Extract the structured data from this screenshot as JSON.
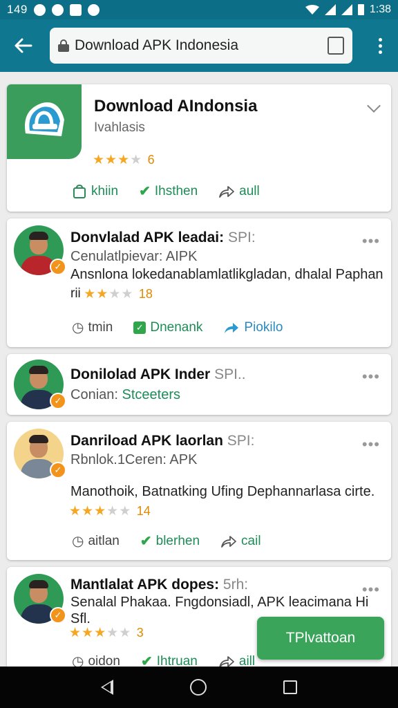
{
  "status_bar": {
    "time_left": "149",
    "time_right": "1:38"
  },
  "browser": {
    "url": "Download APK Indonesia",
    "tab_count": ""
  },
  "featured": {
    "title": "Download AIndonsia",
    "subtitle": "Ivahlasis",
    "rating": 3,
    "rating_label": "6",
    "actions": [
      "khiin",
      "Ihsthen",
      "aull"
    ]
  },
  "cards": [
    {
      "title": "Donvlalad APK leadai:",
      "title_muted": "SPI:",
      "line1": "Cenulatlpievar: AIPK",
      "line2": "Ansnlona lokedanablamlatlikgladan, dhalal Paphan",
      "rating_prefix": "rii",
      "rating": 2.5,
      "rating_label": "18",
      "actions": [
        "tmin",
        "Dnenank",
        "Piokilo"
      ]
    },
    {
      "title": "Donilolad  APK Inder",
      "title_muted": "SPI..",
      "line1": "Conian:",
      "line1_green": "Stceeters"
    },
    {
      "title": "Danriload APK  laorlan",
      "title_muted": "SPI:",
      "line1": "Rbnlok.1Ceren: APK",
      "line2": "Manothoik, Batnatking Ufing Dephannarlasa cirte.",
      "rating": 3.5,
      "rating_label": "14",
      "actions": [
        "aitlan",
        "blerhen",
        "cail"
      ]
    },
    {
      "title": "Mantlalat APK dopes:",
      "title_muted": "5rh:",
      "line1": "Senalal Phakaa. Fngdonsiadl, APK leacimana Hi",
      "line2": "Sfl.",
      "rating": 3.5,
      "rating_label": "3",
      "actions": [
        "oidon",
        "Ihtruan",
        "aill"
      ]
    }
  ],
  "fab": {
    "label": "TPlvattoan"
  },
  "colors": {
    "primary": "#0f7890",
    "accent": "#3aa55a",
    "star": "#f5a623",
    "verified": "#f2931c"
  }
}
